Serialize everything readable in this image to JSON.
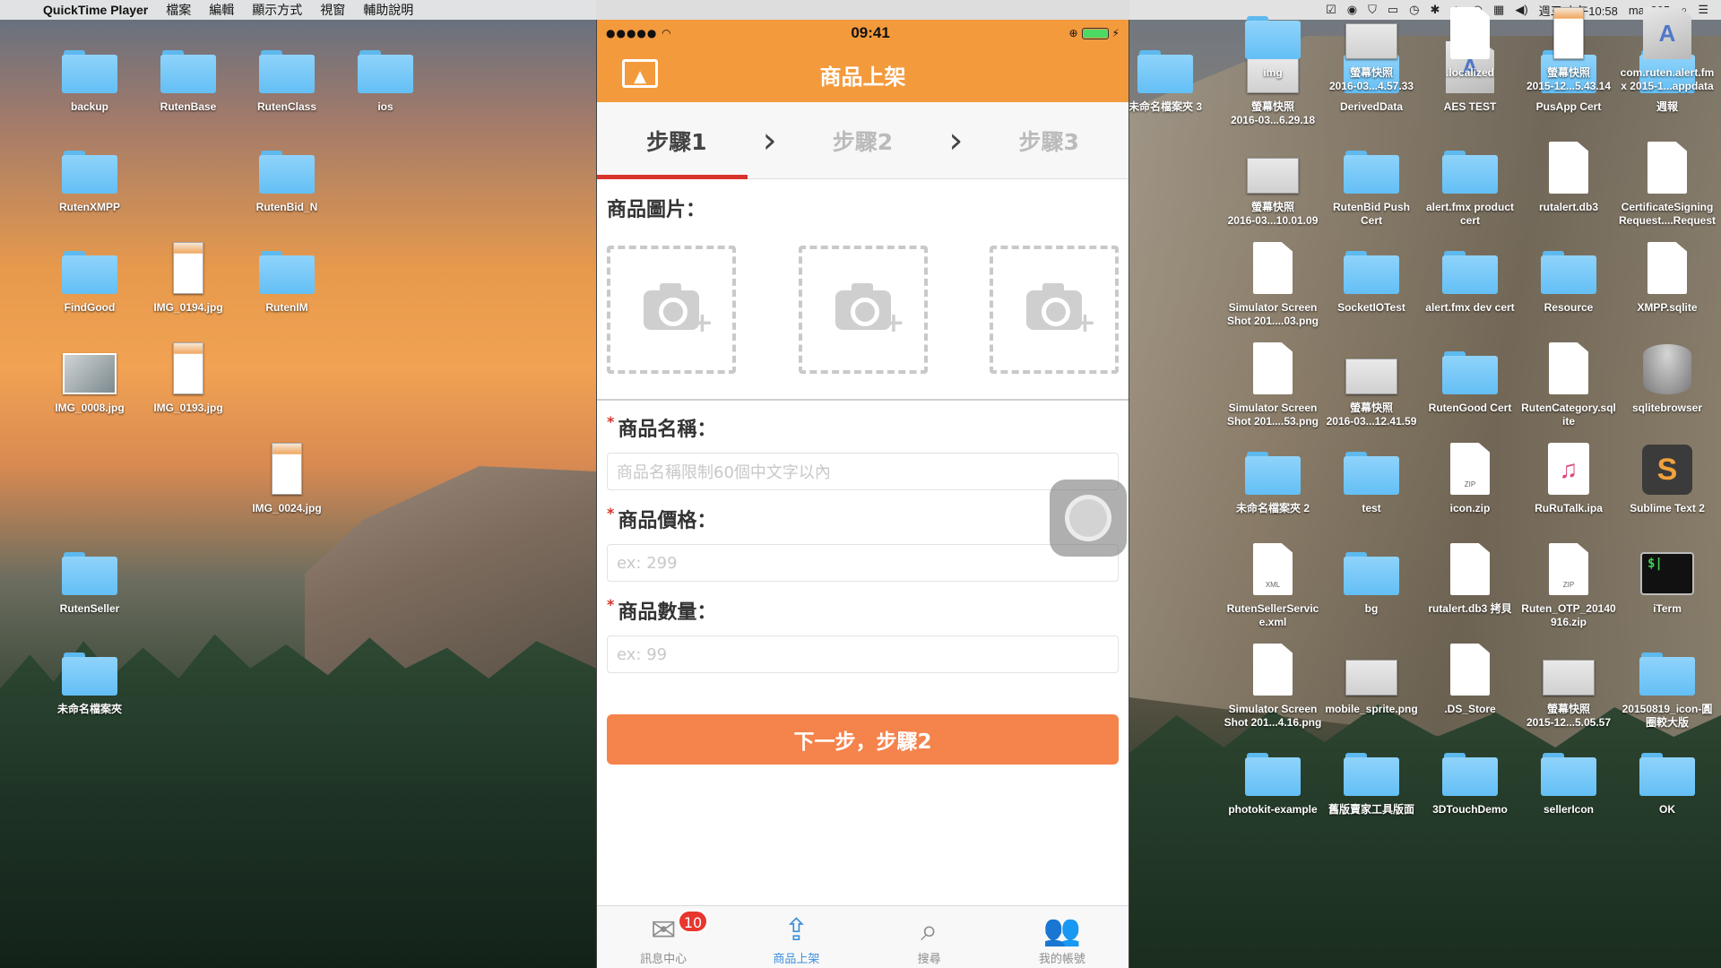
{
  "menubar": {
    "app": "QuickTime Player",
    "items": [
      "檔案",
      "編輯",
      "顯示方式",
      "視窗",
      "輔助說明"
    ],
    "clock": "週三 上午10:58",
    "user": "max205"
  },
  "desktop_left": [
    {
      "label": "backup",
      "type": "folder"
    },
    {
      "label": "RutenBase",
      "type": "folder"
    },
    {
      "label": "RutenClass",
      "type": "folder"
    },
    {
      "label": "ios",
      "type": "folder"
    },
    {
      "label": "RutenXMPP",
      "type": "folder"
    },
    {
      "label": "RutenBid_N",
      "type": "folder"
    },
    {
      "label": "FindGood",
      "type": "folder"
    },
    {
      "label": "IMG_0194.jpg",
      "type": "phone"
    },
    {
      "label": "RutenIM",
      "type": "folder"
    },
    {
      "label": "IMG_0008.jpg",
      "type": "image"
    },
    {
      "label": "IMG_0193.jpg",
      "type": "phone"
    },
    {
      "label": "IMG_0024.jpg",
      "type": "phone"
    },
    {
      "label": "RutenSeller",
      "type": "folder"
    },
    {
      "label": "未命名檔案夾",
      "type": "folder"
    }
  ],
  "desktop_right": [
    {
      "label": "未命名檔案夾 3",
      "type": "folder"
    },
    {
      "label": "螢幕快照\n2016-03...6.29.18",
      "type": "screen"
    },
    {
      "label": "DerivedData",
      "type": "folder"
    },
    {
      "label": "AES TEST",
      "type": "xcode"
    },
    {
      "label": "PusApp Cert",
      "type": "folder"
    },
    {
      "label": "週報",
      "type": "folder"
    },
    {
      "label": "螢幕快照\n2016-03...10.01.09",
      "type": "screen"
    },
    {
      "label": "RutenBid Push\nCert",
      "type": "folder"
    },
    {
      "label": "alert.fmx product\ncert",
      "type": "folder"
    },
    {
      "label": "rutalert.db3",
      "type": "doc"
    },
    {
      "label": "CertificateSigning\nRequest....Request",
      "type": "doc"
    },
    {
      "label": "Simulator Screen\nShot 201....03.png",
      "type": "doc"
    },
    {
      "label": "SocketIOTest",
      "type": "folder"
    },
    {
      "label": "alert.fmx dev cert",
      "type": "folder"
    },
    {
      "label": "Resource",
      "type": "folder"
    },
    {
      "label": "XMPP.sqlite",
      "type": "doc"
    },
    {
      "label": "Simulator Screen\nShot 201....53.png",
      "type": "doc"
    },
    {
      "label": "螢幕快照\n2016-03...12.41.59",
      "type": "screen"
    },
    {
      "label": "RutenGood Cert",
      "type": "folder"
    },
    {
      "label": "RutenCategory.sql\nite",
      "type": "doc"
    },
    {
      "label": "sqlitebrowser",
      "type": "db"
    },
    {
      "label": "未命名檔案夾 2",
      "type": "folder"
    },
    {
      "label": "test",
      "type": "folder"
    },
    {
      "label": "icon.zip",
      "type": "zip"
    },
    {
      "label": "RuRuTalk.ipa",
      "type": "ipa"
    },
    {
      "label": "Sublime Text 2",
      "type": "sublime"
    },
    {
      "label": "RutenSellerServic\ne.xml",
      "type": "xml"
    },
    {
      "label": "bg",
      "type": "folder"
    },
    {
      "label": "rutalert.db3 拷貝",
      "type": "doc"
    },
    {
      "label": "Ruten_OTP_20140\n916.zip",
      "type": "zip"
    },
    {
      "label": "iTerm",
      "type": "term"
    },
    {
      "label": "Simulator Screen\nShot 201...4.16.png",
      "type": "doc"
    },
    {
      "label": "mobile_sprite.png",
      "type": "screen"
    },
    {
      "label": ".DS_Store",
      "type": "doc"
    },
    {
      "label": "螢幕快照\n2015-12...5.05.57",
      "type": "screen"
    },
    {
      "label": "20150819_icon-圓\n圈較大版",
      "type": "folder"
    },
    {
      "label": "photokit-example",
      "type": "folder"
    },
    {
      "label": "舊版賣家工具版面",
      "type": "folder"
    },
    {
      "label": "3DTouchDemo",
      "type": "folder"
    },
    {
      "label": "sellerIcon",
      "type": "folder"
    },
    {
      "label": "OK",
      "type": "folder"
    },
    {
      "label": "img",
      "type": "folder"
    },
    {
      "label": "螢幕快照\n2016-03...4.57.33",
      "type": "screen"
    },
    {
      "label": ".localized",
      "type": "doc"
    },
    {
      "label": "螢幕快照\n2015-12...5.43.14",
      "type": "phone"
    },
    {
      "label": "com.ruten.alert.fm\nx 2015-1...appdata",
      "type": "xcode"
    }
  ],
  "phone": {
    "status_time": "09:41",
    "signal": "●●●●● ",
    "nav_title": "商品上架",
    "steps": [
      "步驟1",
      "步驟2",
      "步驟3"
    ],
    "photos_label": "商品圖片：",
    "name_label": "商品名稱：",
    "name_placeholder": "商品名稱限制60個中文字以內",
    "price_label": "商品價格：",
    "price_placeholder": "ex: 299",
    "qty_label": "商品數量：",
    "qty_placeholder": "ex: 99",
    "required_mark": "*",
    "next_button": "下一步，步驟2",
    "tabs": [
      {
        "label": "訊息中心",
        "icon": "mail-icon"
      },
      {
        "label": "商品上架",
        "icon": "upload-icon"
      },
      {
        "label": "搜尋",
        "icon": "search-icon"
      },
      {
        "label": "我的帳號",
        "icon": "people-icon"
      }
    ],
    "badge": "10"
  },
  "colors": {
    "accent": "#f39a3d",
    "button": "#f5834c",
    "step_underline": "#d9342b",
    "tab_active": "#3b8fdc"
  }
}
